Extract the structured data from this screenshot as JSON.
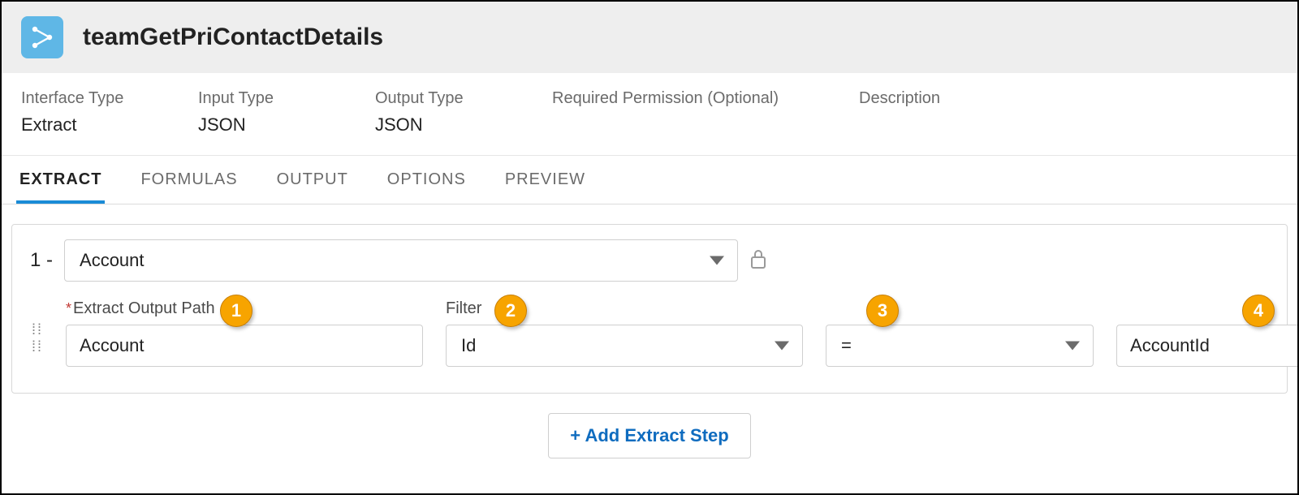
{
  "header": {
    "title": "teamGetPriContactDetails"
  },
  "meta": {
    "interfaceType": {
      "label": "Interface Type",
      "value": "Extract"
    },
    "inputType": {
      "label": "Input Type",
      "value": "JSON"
    },
    "outputType": {
      "label": "Output Type",
      "value": "JSON"
    },
    "requiredPerm": {
      "label": "Required Permission (Optional)",
      "value": ""
    },
    "description": {
      "label": "Description",
      "value": ""
    }
  },
  "tabs": {
    "extract": "EXTRACT",
    "formulas": "FORMULAS",
    "output": "OUTPUT",
    "options": "OPTIONS",
    "preview": "PREVIEW"
  },
  "step": {
    "index": "1 ",
    "dash": "-",
    "object": "Account",
    "outputPathLabel": "Extract Output Path",
    "outputPathValue": "Account",
    "filterLabel": "Filter",
    "filterValue": "Id",
    "operatorValue": "=",
    "valueField": "AccountId"
  },
  "callouts": {
    "c1": "1",
    "c2": "2",
    "c3": "3",
    "c4": "4"
  },
  "footer": {
    "addStep": "+ Add Extract Step"
  }
}
